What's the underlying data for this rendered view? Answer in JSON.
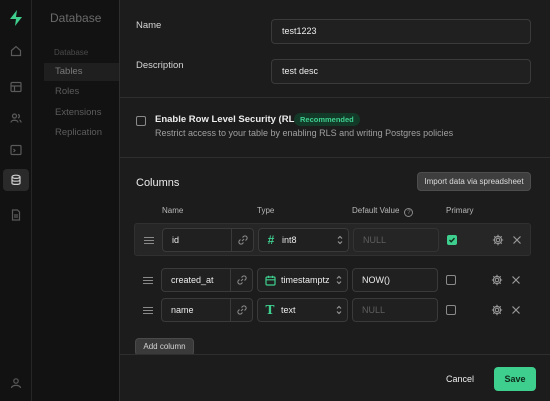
{
  "sidebar": {
    "title": "Database",
    "section_heading": "Database",
    "items": [
      {
        "label": "Tables"
      },
      {
        "label": "Roles"
      },
      {
        "label": "Extensions"
      },
      {
        "label": "Replication"
      }
    ]
  },
  "form": {
    "name_label": "Name",
    "name_value": "test1223",
    "description_label": "Description",
    "description_value": "test desc",
    "rls_title": "Enable Row Level Security (RLS)",
    "rls_badge": "Recommended",
    "rls_description": "Restrict access to your table by enabling RLS and writing Postgres policies",
    "rls_checked": false
  },
  "columns": {
    "title": "Columns",
    "import_label": "Import data via spreadsheet",
    "headers": {
      "name": "Name",
      "type": "Type",
      "default": "Default Value",
      "primary": "Primary"
    },
    "rows": [
      {
        "name": "id",
        "type": "int8",
        "type_icon": "hash-icon",
        "default": "",
        "default_placeholder": "NULL",
        "primary": true
      },
      {
        "name": "created_at",
        "type": "timestamptz",
        "type_icon": "calendar-icon",
        "default": "NOW()",
        "default_placeholder": "",
        "primary": false
      },
      {
        "name": "name",
        "type": "text",
        "type_icon": "text-t-icon",
        "default": "",
        "default_placeholder": "NULL",
        "primary": false
      }
    ],
    "add_label": "Add column"
  },
  "footer": {
    "cancel_label": "Cancel",
    "save_label": "Save"
  },
  "colors": {
    "accent": "#3ecf8e",
    "background": "#1c1c1c",
    "badge_bg": "#133a29"
  }
}
